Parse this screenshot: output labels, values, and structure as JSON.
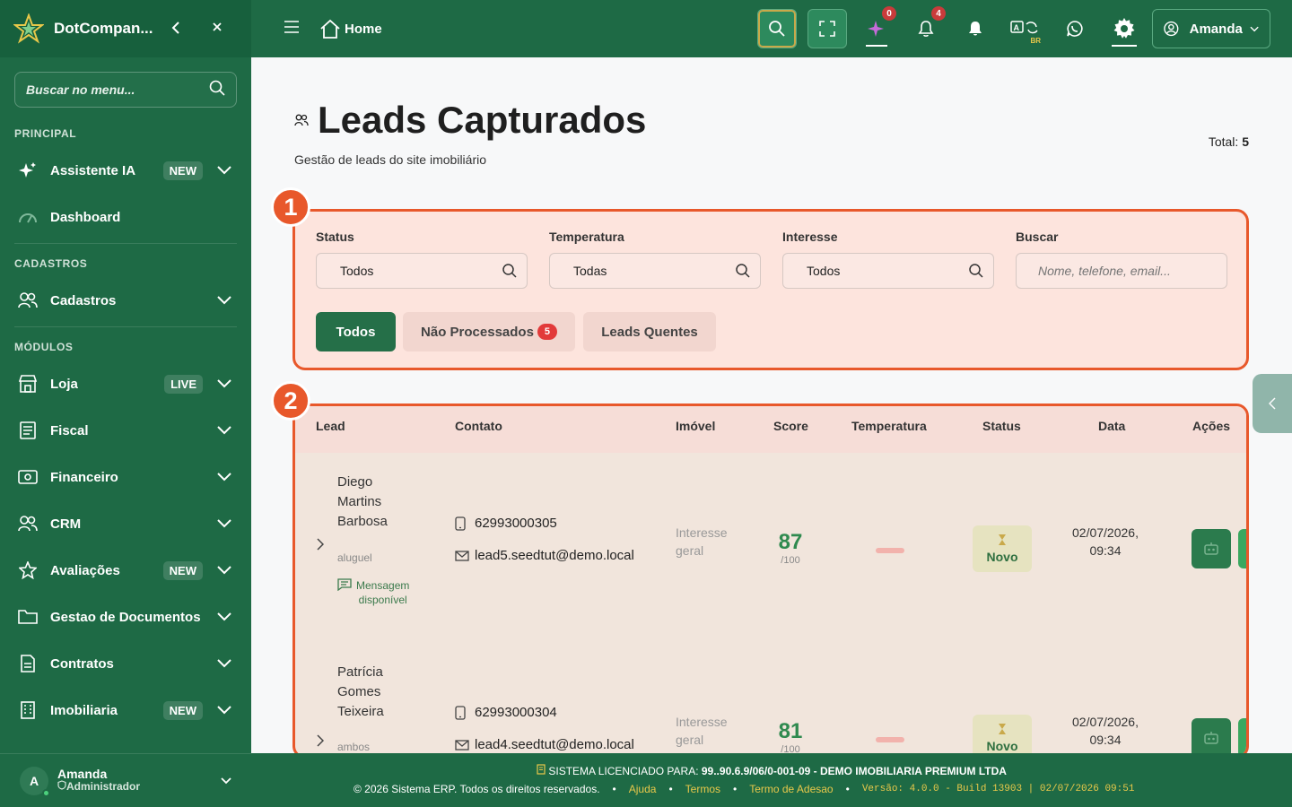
{
  "app": {
    "name": "DotCompan..."
  },
  "sidebar": {
    "search_placeholder": "Buscar no menu...",
    "sections": {
      "principal": "PRINCIPAL",
      "cadastros": "CADASTROS",
      "modulos": "MÓDULOS"
    },
    "items": [
      {
        "label": "Assistente IA",
        "badge": "NEW"
      },
      {
        "label": "Dashboard",
        "badge": ""
      },
      {
        "label": "Cadastros",
        "badge": ""
      },
      {
        "label": "Loja",
        "badge": "LIVE"
      },
      {
        "label": "Fiscal",
        "badge": ""
      },
      {
        "label": "Financeiro",
        "badge": ""
      },
      {
        "label": "CRM",
        "badge": ""
      },
      {
        "label": "Avaliações",
        "badge": "NEW"
      },
      {
        "label": "Gestao de Documentos",
        "badge": ""
      },
      {
        "label": "Contratos",
        "badge": ""
      },
      {
        "label": "Imobiliaria",
        "badge": "NEW"
      }
    ],
    "user": {
      "initial": "A",
      "name": "Amanda",
      "role": "Administrador"
    }
  },
  "topbar": {
    "home": "Home",
    "ai_badge": "0",
    "notif_badge": "4",
    "lang_tag": "BR",
    "user": "Amanda"
  },
  "page": {
    "title": "Leads Capturados",
    "subtitle": "Gestão de leads do site imobiliário",
    "total_label": "Total:",
    "total_value": "5"
  },
  "filters": {
    "status": {
      "label": "Status",
      "value": "Todos"
    },
    "temperatura": {
      "label": "Temperatura",
      "value": "Todas"
    },
    "interesse": {
      "label": "Interesse",
      "value": "Todos"
    },
    "buscar": {
      "label": "Buscar",
      "placeholder": "Nome, telefone, email..."
    },
    "tabs": [
      {
        "label": "Todos",
        "active": true
      },
      {
        "label": "Não Processados",
        "count": "5"
      },
      {
        "label": "Leads Quentes"
      }
    ]
  },
  "annotations": [
    "1",
    "2"
  ],
  "table": {
    "headers": [
      "Lead",
      "Contato",
      "Imóvel",
      "Score",
      "Temperatura",
      "Status",
      "Data",
      "Ações"
    ],
    "rows": [
      {
        "name_lines": [
          "Diego",
          "Martins",
          "Barbosa"
        ],
        "type": "aluguel",
        "message": [
          "Mensagem",
          "disponível"
        ],
        "phone": "62993000305",
        "email": "lead5.seedtut@demo.local",
        "imovel": [
          "Interesse",
          "geral"
        ],
        "score": "87",
        "score_max": "/100",
        "status": "Novo",
        "date": [
          "02/07/2026,",
          "09:34"
        ]
      },
      {
        "name_lines": [
          "Patrícia",
          "Gomes",
          "Teixeira"
        ],
        "type": "ambos",
        "phone": "62993000304",
        "email": "lead4.seedtut@demo.local",
        "imovel": [
          "Interesse",
          "geral"
        ],
        "score": "81",
        "score_max": "/100",
        "status": "Novo",
        "date": [
          "02/07/2026,",
          "09:34"
        ]
      }
    ]
  },
  "footer": {
    "license_label": "SISTEMA LICENCIADO PARA:",
    "license_value": "99..90.6.9/06/0-001-09 - DEMO IMOBILIARIA PREMIUM LTDA",
    "copyright": "© 2026 Sistema ERP. Todos os direitos reservados.",
    "links": [
      "Ajuda",
      "Termos",
      "Termo de Adesao"
    ],
    "version": "Versão: 4.0.0 - Build 13903 | 02/07/2026 09:51"
  },
  "colors": {
    "primary": "#1e6a45",
    "accent": "#e8582b",
    "score": "#2f8a4f",
    "badge_red": "#e23a3a"
  }
}
